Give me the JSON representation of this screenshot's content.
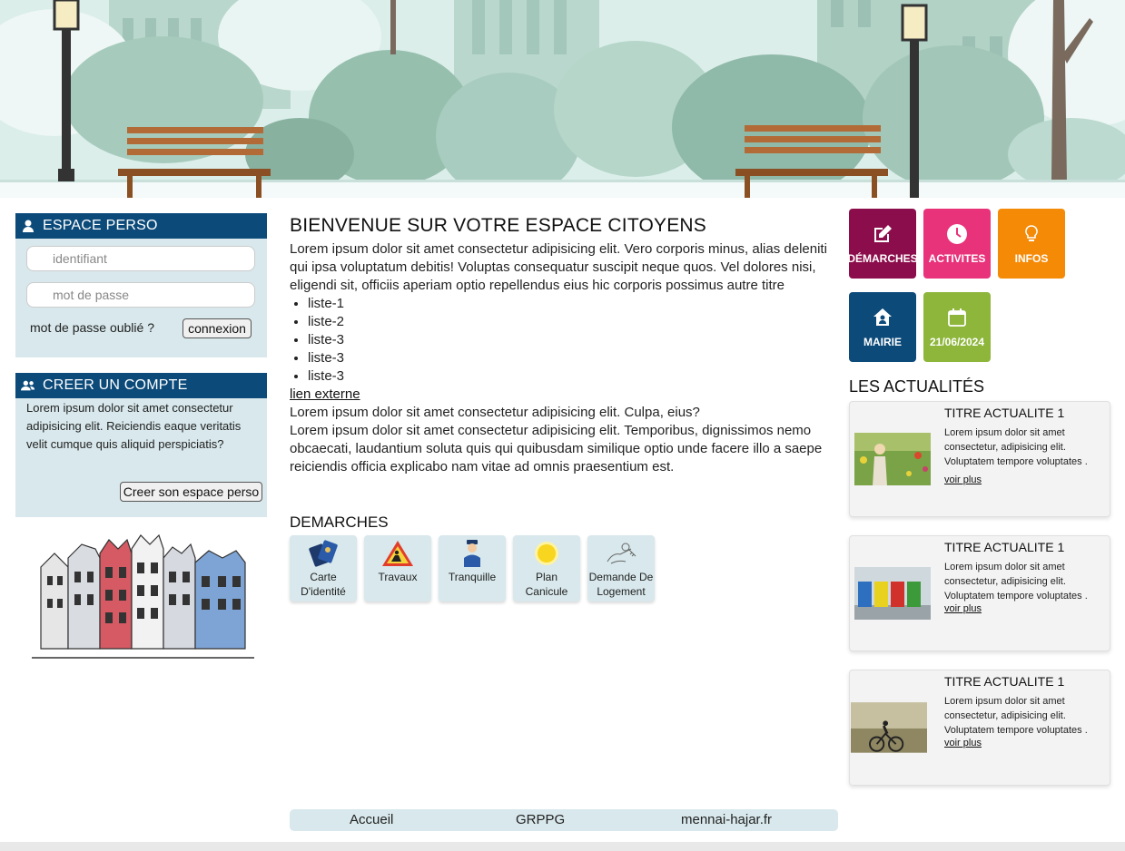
{
  "login": {
    "title": "ESPACE PERSO",
    "id_placeholder": "identifiant",
    "pw_placeholder": "mot de passe",
    "forgot": "mot de passe oublié ?",
    "connect": "connexion"
  },
  "account": {
    "title": "CREER UN COMPTE",
    "text": "Lorem ipsum dolor sit amet consectetur adipisicing elit. Reiciendis eaque veritatis velit cumque quis aliquid perspiciatis?",
    "button": "Creer son espace perso"
  },
  "main": {
    "title": "BIENVENUE SUR VOTRE ESPACE CITOYENS",
    "intro": "Lorem ipsum dolor sit amet consectetur adipisicing elit. Vero corporis minus, alias deleniti qui ipsa voluptatum debitis! Voluptas consequatur suscipit neque quos. Vel dolores nisi, eligendi sit, officiis aperiam optio repellendus eius hic corporis possimus autre titre",
    "list": [
      "liste-1",
      "liste-2",
      "liste-3",
      "liste-3",
      "liste-3"
    ],
    "link": "lien externe",
    "para1": "Lorem ipsum dolor sit amet consectetur adipisicing elit. Culpa, eius?",
    "para2": "Lorem ipsum dolor sit amet consectetur adipisicing elit. Temporibus, dignissimos nemo obcaecati, laudantium soluta quis qui quibusdam similique optio unde facere illo a saepe reiciendis officia explicabo nam vitae ad omnis praesentium est."
  },
  "demarches": {
    "title": "DEMARCHES",
    "items": [
      {
        "label": "Carte D'identité",
        "icon": "id-card-icon"
      },
      {
        "label": "Travaux",
        "icon": "roadworks-icon"
      },
      {
        "label": "Tranquille",
        "icon": "police-icon"
      },
      {
        "label": "Plan Canicule",
        "icon": "sun-icon"
      },
      {
        "label": "Demande De Logement",
        "icon": "key-hand-icon"
      }
    ]
  },
  "footer": {
    "links": [
      "Accueil",
      "GRPPG",
      "mennai-hajar.fr"
    ]
  },
  "tiles": [
    {
      "label": "DÉMARCHES",
      "color": "#8c0d4b",
      "icon": "edit-icon"
    },
    {
      "label": "ACTIVITES",
      "color": "#e8337b",
      "icon": "clock-icon"
    },
    {
      "label": "INFOS",
      "color": "#f58a07",
      "icon": "lightbulb-icon"
    },
    {
      "label": "MAIRIE",
      "color": "#0c4a7a",
      "icon": "town-hall-icon"
    },
    {
      "label": "21/06/2024",
      "color": "#8db63b",
      "icon": "calendar-icon"
    }
  ],
  "news": {
    "title": "LES ACTUALITÉS",
    "items": [
      {
        "title": "TITRE ACTUALITE 1",
        "text": "Lorem ipsum dolor sit amet consectetur, adipisicing elit. Voluptatem tempore voluptates .",
        "more": "voir plus"
      },
      {
        "title": "TITRE ACTUALITE 1",
        "text": "Lorem ipsum dolor sit amet consectetur, adipisicing elit. Voluptatem tempore voluptates .",
        "more": "voir plus"
      },
      {
        "title": "TITRE ACTUALITE 1",
        "text": "Lorem ipsum dolor sit amet consectetur, adipisicing elit. Voluptatem tempore voluptates .",
        "more": "voir plus"
      }
    ]
  }
}
